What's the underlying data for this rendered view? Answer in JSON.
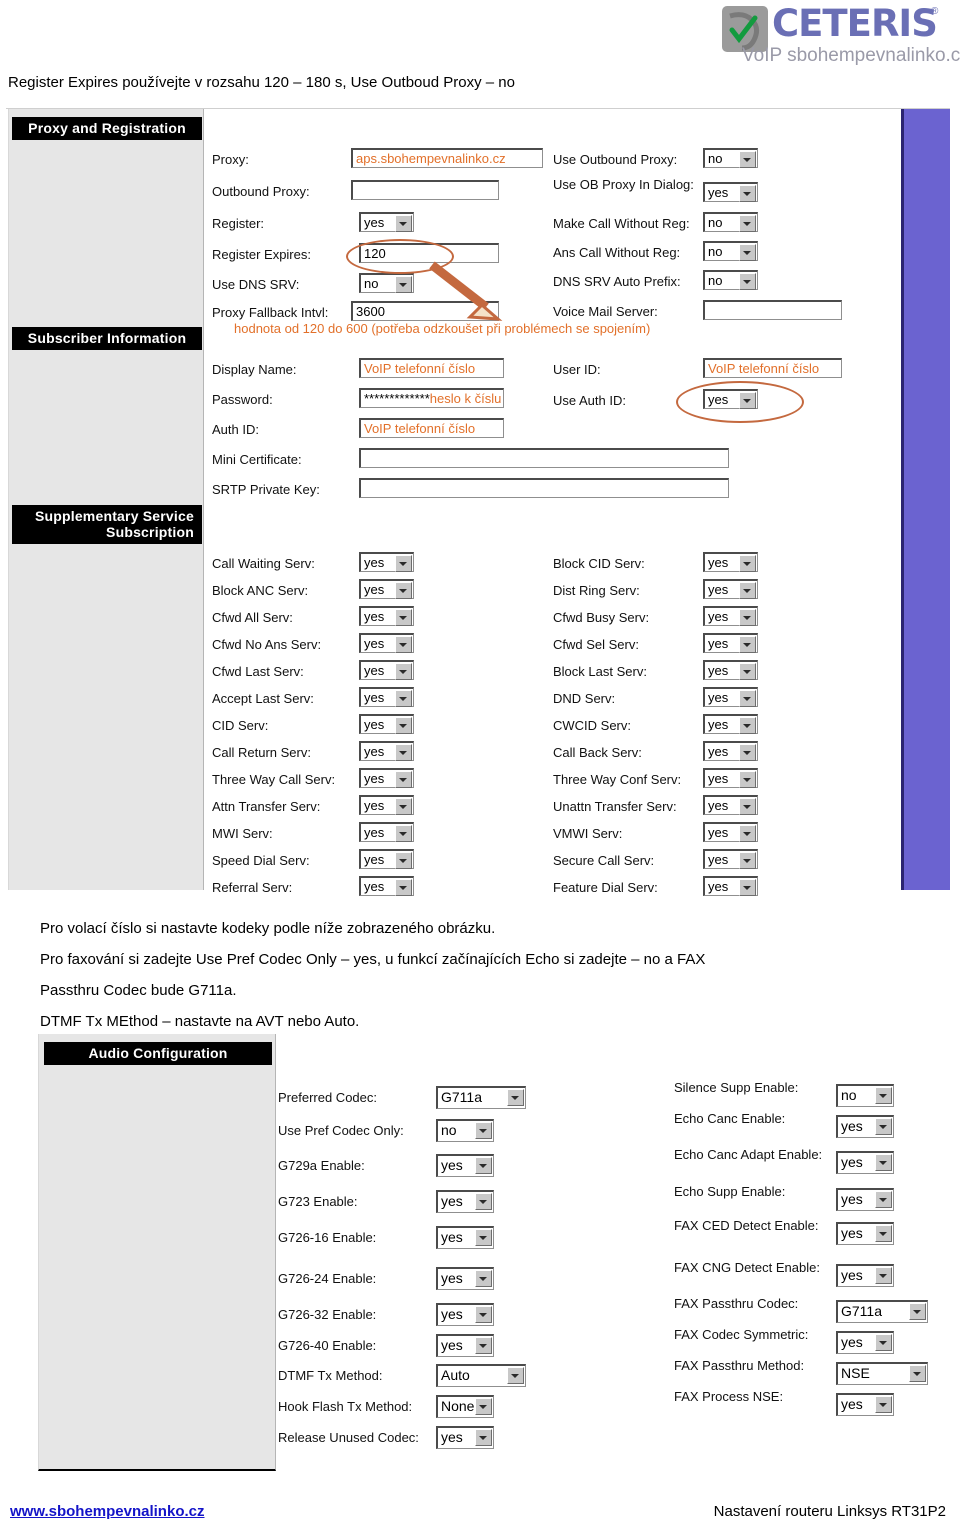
{
  "header": {
    "logo_word": "CETERIS",
    "logo_reg": "®",
    "logo_sub": "VoIP sbohempevnalinko.cz",
    "intro": "Register Expires používejte v rozsahu 120 – 180 s, Use Outboud Proxy – no"
  },
  "colors": {
    "accent_purple": "#6B63D0",
    "annotation_orange": "#E2702A",
    "circle_brown": "#C4693F",
    "link_blue": "#1414C8",
    "panel_gray": "#E6E6E6"
  },
  "proxy_shot": {
    "sections": {
      "proxy_registration": "Proxy and Registration",
      "subscriber_information": "Subscriber Information",
      "supplementary_service": "Supplementary Service Subscription"
    },
    "left_fields": [
      {
        "label": "Proxy:",
        "value": "aps.sbohempevnalinko.cz",
        "type": "text",
        "orange": true
      },
      {
        "label": "Outbound Proxy:",
        "value": "",
        "type": "text",
        "orange": false
      },
      {
        "label": "Register:",
        "value": "yes",
        "type": "select"
      },
      {
        "label": "Register Expires:",
        "value": "120",
        "type": "text",
        "orange": false
      },
      {
        "label": "Use DNS SRV:",
        "value": "no",
        "type": "select"
      },
      {
        "label": "Proxy Fallback Intvl:",
        "value": "3600",
        "type": "text",
        "orange": false
      }
    ],
    "right_fields": [
      {
        "label": "Use Outbound Proxy:",
        "value": "no",
        "type": "select"
      },
      {
        "label": "Use OB Proxy In Dialog:",
        "value": "yes",
        "type": "select"
      },
      {
        "label": "Make Call Without Reg:",
        "value": "no",
        "type": "select"
      },
      {
        "label": "Ans Call Without Reg:",
        "value": "no",
        "type": "select"
      },
      {
        "label": "DNS SRV Auto Prefix:",
        "value": "no",
        "type": "select"
      },
      {
        "label": "Voice Mail Server:",
        "value": "",
        "type": "text",
        "orange": false
      }
    ],
    "annotation_note": "hodnota od 120 do 600 (potřeba odzkoušet při problémech se spojením)",
    "subscriber_left": [
      {
        "label": "Display Name:",
        "value": "VoIP telefonní číslo",
        "type": "text",
        "orange": true
      },
      {
        "label": "Password:",
        "value": "*************",
        "suffix": "heslo k číslu",
        "type": "text",
        "orange": false
      },
      {
        "label": "Auth ID:",
        "value": "VoIP telefonní číslo",
        "type": "text",
        "orange": true
      },
      {
        "label": "Mini Certificate:",
        "value": "",
        "type": "text",
        "orange": false
      },
      {
        "label": "SRTP Private Key:",
        "value": "",
        "type": "text",
        "orange": false
      }
    ],
    "subscriber_right": [
      {
        "label": "User ID:",
        "value": "VoIP telefonní číslo",
        "type": "text",
        "orange": true
      },
      {
        "label": "Use Auth ID:",
        "value": "yes",
        "type": "select"
      }
    ],
    "supp_left": [
      {
        "label": "Call Waiting Serv:",
        "value": "yes"
      },
      {
        "label": "Block ANC Serv:",
        "value": "yes"
      },
      {
        "label": "Cfwd All Serv:",
        "value": "yes"
      },
      {
        "label": "Cfwd No Ans Serv:",
        "value": "yes"
      },
      {
        "label": "Cfwd Last Serv:",
        "value": "yes"
      },
      {
        "label": "Accept Last Serv:",
        "value": "yes"
      },
      {
        "label": "CID Serv:",
        "value": "yes"
      },
      {
        "label": "Call Return Serv:",
        "value": "yes"
      },
      {
        "label": "Three Way Call Serv:",
        "value": "yes"
      },
      {
        "label": "Attn Transfer Serv:",
        "value": "yes"
      },
      {
        "label": "MWI Serv:",
        "value": "yes"
      },
      {
        "label": "Speed Dial Serv:",
        "value": "yes"
      },
      {
        "label": "Referral Serv:",
        "value": "yes"
      }
    ],
    "supp_right": [
      {
        "label": "Block CID Serv:",
        "value": "yes"
      },
      {
        "label": "Dist Ring Serv:",
        "value": "yes"
      },
      {
        "label": "Cfwd Busy Serv:",
        "value": "yes"
      },
      {
        "label": "Cfwd Sel Serv:",
        "value": "yes"
      },
      {
        "label": "Block Last Serv:",
        "value": "yes"
      },
      {
        "label": "DND Serv:",
        "value": "yes"
      },
      {
        "label": "CWCID Serv:",
        "value": "yes"
      },
      {
        "label": "Call Back Serv:",
        "value": "yes"
      },
      {
        "label": "Three Way Conf Serv:",
        "value": "yes"
      },
      {
        "label": "Unattn Transfer Serv:",
        "value": "yes"
      },
      {
        "label": "VMWI Serv:",
        "value": "yes"
      },
      {
        "label": "Secure Call Serv:",
        "value": "yes"
      },
      {
        "label": "Feature Dial Serv:",
        "value": "yes"
      }
    ]
  },
  "paragraphs": [
    "Pro volací číslo si nastavte kodeky podle níže zobrazeného obrázku.",
    "Pro faxování si zadejte Use Pref Codec Only – yes, u funkcí začínajících Echo si zadejte – no a FAX",
    "Passthru Codec bude G711a.",
    "DTMF Tx MEthod – nastavte na AVT nebo Auto."
  ],
  "audio_shot": {
    "section_title": "Audio Configuration",
    "left_fields": [
      {
        "label": "Preferred Codec:",
        "value": "G711a",
        "wide": true
      },
      {
        "label": "Use Pref Codec Only:",
        "value": "no"
      },
      {
        "label": "G729a Enable:",
        "value": "yes"
      },
      {
        "label": "G723 Enable:",
        "value": "yes"
      },
      {
        "label": "G726-16 Enable:",
        "value": "yes"
      },
      {
        "label": "G726-24 Enable:",
        "value": "yes"
      },
      {
        "label": "G726-32 Enable:",
        "value": "yes"
      },
      {
        "label": "G726-40 Enable:",
        "value": "yes"
      },
      {
        "label": "DTMF Tx Method:",
        "value": "Auto",
        "wide": true
      },
      {
        "label": "Hook Flash Tx Method:",
        "value": "None"
      },
      {
        "label": "Release Unused Codec:",
        "value": "yes"
      }
    ],
    "right_fields": [
      {
        "label": "Silence Supp Enable:",
        "value": "no"
      },
      {
        "label": "Echo Canc Enable:",
        "value": "yes"
      },
      {
        "label": "Echo Canc Adapt Enable:",
        "value": "yes"
      },
      {
        "label": "Echo Supp Enable:",
        "value": "yes"
      },
      {
        "label": "FAX CED Detect Enable:",
        "value": "yes"
      },
      {
        "label": "FAX CNG Detect Enable:",
        "value": "yes"
      },
      {
        "label": "FAX Passthru Codec:",
        "value": "G711a",
        "wide": true
      },
      {
        "label": "FAX Codec Symmetric:",
        "value": "yes"
      },
      {
        "label": "FAX Passthru Method:",
        "value": "NSE",
        "wide": true
      },
      {
        "label": "FAX Process NSE:",
        "value": "yes"
      }
    ]
  },
  "footer": {
    "link": "www.sbohempevnalinko.cz",
    "right": "Nastavení routeru Linksys RT31P2"
  }
}
